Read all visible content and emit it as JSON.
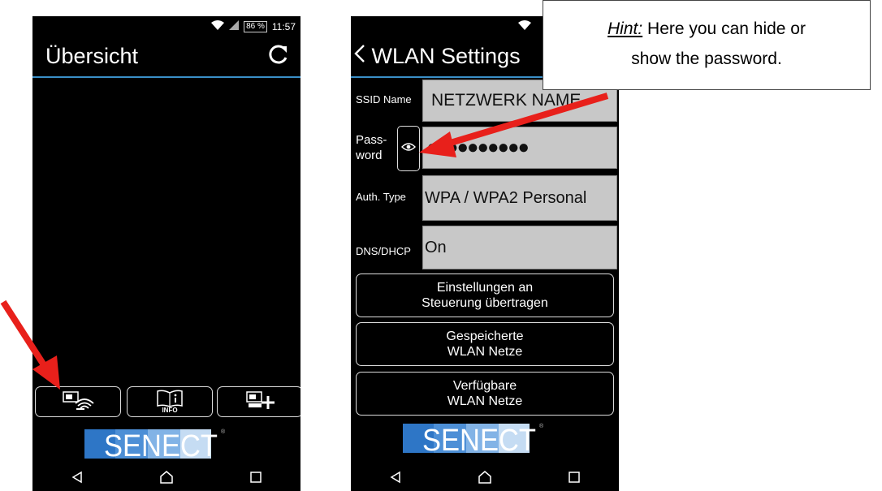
{
  "status": {
    "battery": "86 %",
    "time": "11:57"
  },
  "screen1": {
    "title": "Übersicht",
    "toolbar": [
      {
        "icon": "wifi-device-icon"
      },
      {
        "icon": "info-book-icon",
        "label": "INFO"
      },
      {
        "icon": "add-device-icon"
      }
    ],
    "logo": "SENECT"
  },
  "screen2": {
    "title": "WLAN Settings",
    "fields": {
      "ssid_label": "SSID Name",
      "ssid_value": "NETZWERK NAME",
      "password_label_1": "Pass-",
      "password_label_2": "word",
      "password_value": "●●●●●●●●●●",
      "auth_label": "Auth. Type",
      "auth_value": "WPA / WPA2 Personal",
      "dns_label": "DNS/DHCP",
      "dns_value": "On"
    },
    "buttons": [
      {
        "line1": "Einstellungen an",
        "line2": "Steuerung übertragen"
      },
      {
        "line1": "Gespeicherte",
        "line2": "WLAN Netze"
      },
      {
        "line1": "Verfügbare",
        "line2": "WLAN Netze"
      }
    ],
    "logo": "SENECT"
  },
  "hint": {
    "label": "Hint:",
    "text_1": "Here you can hide or",
    "text_2": "show the password."
  },
  "colors": {
    "accent": "#3a8fc7",
    "arrow": "#e8201b",
    "field": "#c8c8c8"
  }
}
